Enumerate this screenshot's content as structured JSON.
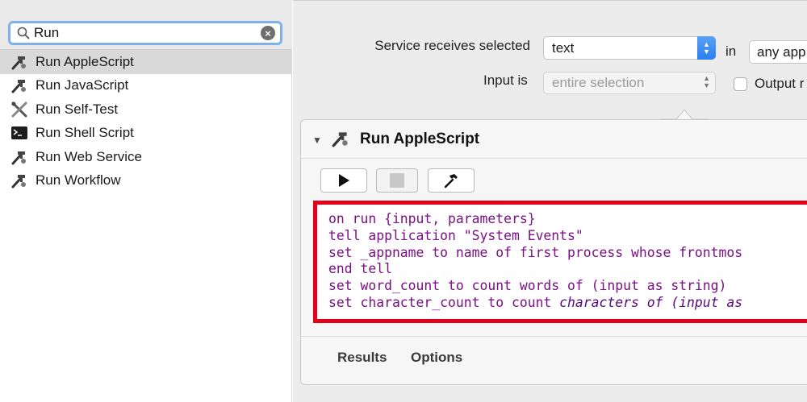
{
  "search": {
    "value": "Run",
    "icon": "magnifier-icon",
    "clear_icon": "clear-circle-icon"
  },
  "library": {
    "items": [
      {
        "label": "Run AppleScript",
        "icon": "applescript-icon",
        "selected": true
      },
      {
        "label": "Run JavaScript",
        "icon": "applescript-icon",
        "selected": false
      },
      {
        "label": "Run Self-Test",
        "icon": "tools-cross-icon",
        "selected": false
      },
      {
        "label": "Run Shell Script",
        "icon": "terminal-icon",
        "selected": false
      },
      {
        "label": "Run Web Service",
        "icon": "applescript-icon",
        "selected": false
      },
      {
        "label": "Run Workflow",
        "icon": "applescript-icon",
        "selected": false
      }
    ]
  },
  "workflow": {
    "service_receives_label": "Service receives selected",
    "service_type": "text",
    "in_label": "in",
    "application": "any app",
    "input_is_label": "Input is",
    "input_is_value": "entire selection",
    "output_label": "Output r",
    "output_checked": false
  },
  "action_card": {
    "title": "Run AppleScript",
    "code_lines": [
      "on run {input, parameters}",
      "tell application \"System Events\"",
      "set _appname to name of first process whose frontmos",
      "end tell",
      "set word_count to count words of (input as string)",
      "set character_count to count "
    ],
    "code_line6_italic": "characters of (input as",
    "tabs": [
      "Results",
      "Options"
    ]
  },
  "colors": {
    "accent_blue": "#2b7ef0",
    "highlight_red": "#e4001b",
    "code_purple": "#7b0f85"
  }
}
